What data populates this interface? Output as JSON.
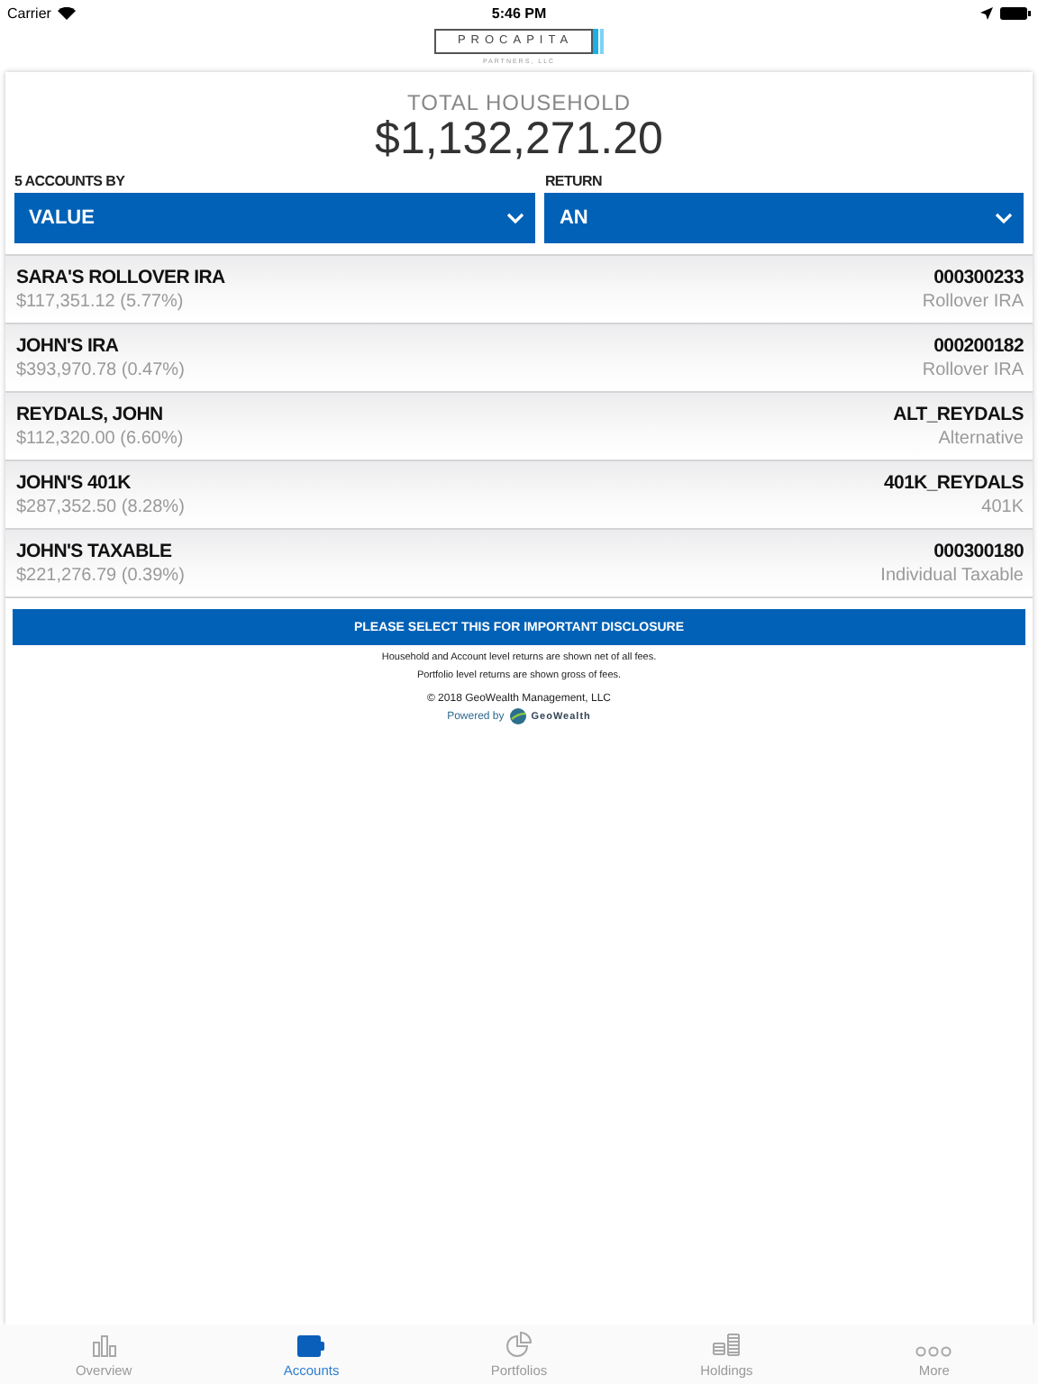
{
  "status_bar": {
    "carrier": "Carrier",
    "time": "5:46 PM"
  },
  "logo": {
    "name": "PROCAPITA",
    "subtitle": "PARTNERS, LLC"
  },
  "total": {
    "label": "TOTAL HOUSEHOLD",
    "amount": "$1,132,271.20"
  },
  "filters": [
    {
      "label": "5 ACCOUNTS BY",
      "value": "VALUE"
    },
    {
      "label": "RETURN",
      "value": "AN"
    }
  ],
  "accounts": [
    {
      "name": "SARA'S ROLLOVER IRA",
      "value": "$117,351.12 (5.77%)",
      "number": "000300233",
      "type": "Rollover IRA"
    },
    {
      "name": "JOHN'S IRA",
      "value": "$393,970.78 (0.47%)",
      "number": "000200182",
      "type": "Rollover IRA"
    },
    {
      "name": "REYDALS, JOHN",
      "value": "$112,320.00 (6.60%)",
      "number": "ALT_REYDALS",
      "type": "Alternative"
    },
    {
      "name": "JOHN'S 401K",
      "value": "$287,352.50 (8.28%)",
      "number": "401K_REYDALS",
      "type": "401K"
    },
    {
      "name": "JOHN'S TAXABLE",
      "value": "$221,276.79 (0.39%)",
      "number": "000300180",
      "type": "Individual Taxable"
    }
  ],
  "disclosure_button": "PLEASE SELECT THIS FOR IMPORTANT DISCLOSURE",
  "notes": [
    "Household and Account level returns are shown net of all fees.",
    "Portfolio level returns are shown gross of fees."
  ],
  "copyright": "© 2018 GeoWealth Management, LLC",
  "powered_by": {
    "label": "Powered by",
    "brand": "GeoWealth"
  },
  "tabs": [
    {
      "kind": "overview",
      "label": "Overview",
      "selected": false
    },
    {
      "kind": "accounts",
      "label": "Accounts",
      "selected": true
    },
    {
      "kind": "portfolios",
      "label": "Portfolios",
      "selected": false
    },
    {
      "kind": "holdings",
      "label": "Holdings",
      "selected": false
    },
    {
      "kind": "more",
      "label": "More",
      "selected": false
    }
  ]
}
